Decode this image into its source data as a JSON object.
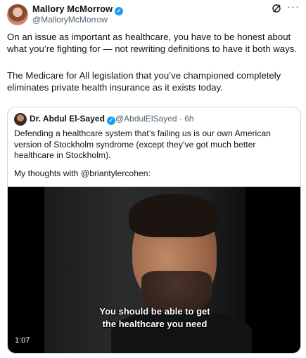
{
  "tweet": {
    "author": {
      "name": "Mallory McMorrow",
      "handle": "@MalloryMcMorrow",
      "verified_icon": "check"
    },
    "actions": {
      "grok_icon": "slashed-circle-icon",
      "more_icon": "···"
    },
    "text_paragraphs": [
      "On an issue as important as healthcare, you have to be honest about what you’re fighting for — not rewriting definitions to have it both ways.",
      "The Medicare for All legislation that you’ve championed completely eliminates private health insurance as it exists today."
    ]
  },
  "quote": {
    "author": {
      "name": "Dr. Abdul El-Sayed",
      "handle_time": "@AbdulElSayed · 6h",
      "verified_icon": "check"
    },
    "text_paragraphs": [
      "Defending a healthcare system that’s failing us is our own American version of Stockholm syndrome (except they’ve got much better healthcare in Stockholm).",
      "My thoughts with @briantylercohen:"
    ],
    "video": {
      "caption_lines": [
        "You should be able to get",
        "the healthcare you need"
      ],
      "duration": "1:07"
    }
  },
  "colors": {
    "verified": "#1d9bf0",
    "secondary_text": "#536471",
    "border": "#cfd9de"
  }
}
